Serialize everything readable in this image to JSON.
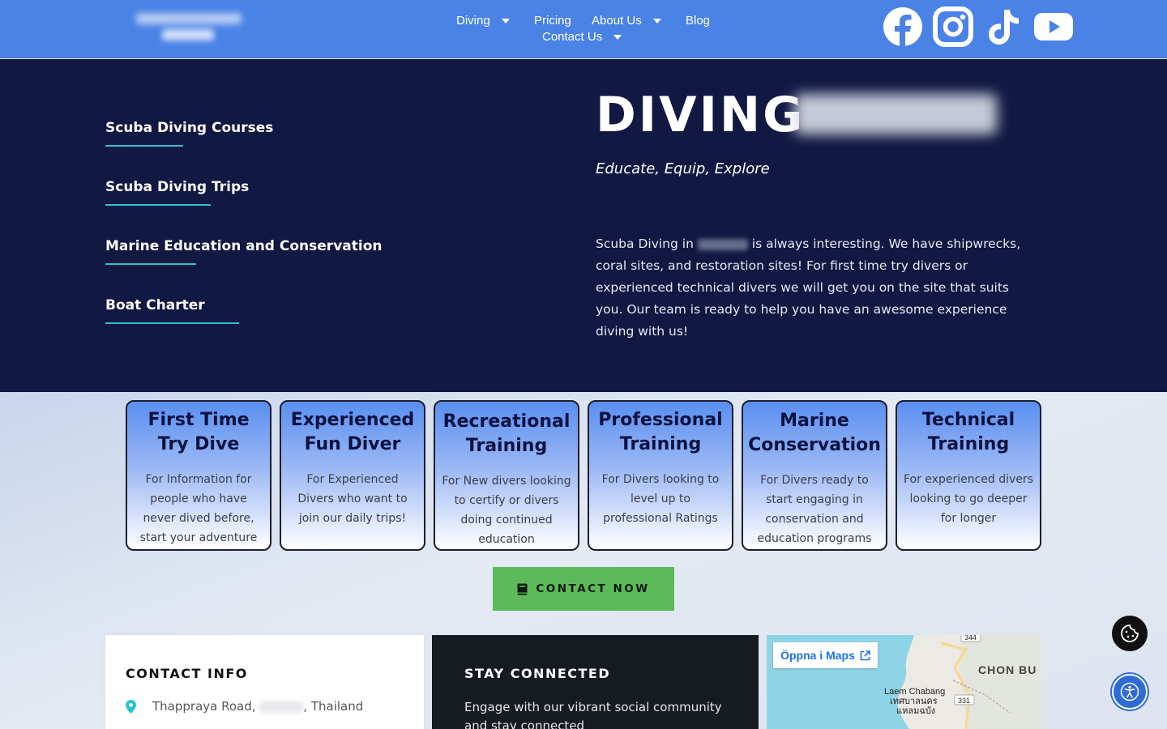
{
  "colors": {
    "header_bg": "#4a82e6",
    "hero_bg": "#111842",
    "accent_line": "#2bc3cf",
    "button_green": "#5cba5a"
  },
  "nav": {
    "diving": "Diving",
    "pricing": "Pricing",
    "about": "About Us",
    "blog": "Blog",
    "contact": "Contact Us"
  },
  "social": [
    "facebook-icon",
    "instagram-icon",
    "tiktok-icon",
    "youtube-icon"
  ],
  "hero": {
    "menu": [
      "Scuba Diving Courses",
      "Scuba Diving Trips",
      "Marine Education and Conservation",
      "Boat Charter"
    ],
    "title": "DIVING",
    "subtitle": "Educate, Equip, Explore",
    "text_before": "Scuba Diving in",
    "text_after": "is always interesting. We have shipwrecks, coral sites, and restoration sites! For first time try divers or experienced technical divers we will get you on the site that suits you. Our team is ready to help you have an awesome experience diving with us!"
  },
  "cards": [
    {
      "title": "First Time Try Dive",
      "desc": "For Information for people who have never dived before, start your adventure here!"
    },
    {
      "title": "Experienced Fun Diver",
      "desc": "For Experienced Divers who want to join our daily trips!"
    },
    {
      "title": "Recreational Training",
      "desc": "For New divers looking to certify or divers doing continued education"
    },
    {
      "title": "Professional Training",
      "desc": "For Divers looking to level up to professional Ratings"
    },
    {
      "title": "Marine Conservation",
      "desc": "For Divers ready to start engaging in conservation and education programs"
    },
    {
      "title": "Technical Training",
      "desc": "For experienced divers looking to go deeper for longer"
    }
  ],
  "cta": {
    "label": "CONTACT NOW"
  },
  "contact_info": {
    "heading": "CONTACT INFO",
    "address_before": "Thappraya Road,",
    "address_after": ", Thailand"
  },
  "stay_connected": {
    "heading": "STAY CONNECTED",
    "text": "Engage with our vibrant social community and stay connected"
  },
  "map": {
    "open_label": "Öppna i Maps",
    "labels": [
      "CHON BU",
      "Laem Chabang",
      "เทศบาลนคร",
      "แหลมฉบัง",
      "344",
      "331"
    ]
  }
}
